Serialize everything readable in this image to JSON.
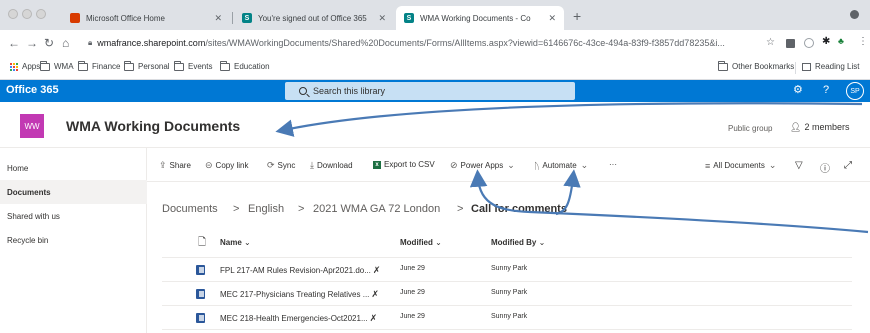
{
  "browser": {
    "tabs": [
      {
        "label": "Microsoft Office Home",
        "fav_color": "#d83b01",
        "fav_letter": ""
      },
      {
        "label": "You're signed out of Office 365",
        "fav_color": "#038387",
        "fav_letter": "S"
      },
      {
        "label": "WMA Working Documents - Co",
        "fav_color": "#038387",
        "fav_letter": "S"
      }
    ],
    "new_tab": "+",
    "url_host": "wmafrance.sharepoint.com",
    "url_path": "/sites/WMAWorkingDocuments/Shared%20Documents/Forms/AllItems.aspx?viewid=6146676c-43ce-494a-83f9-f3857dd78235&i...",
    "bookmarks": [
      "Apps",
      "WMA",
      "Finance",
      "Personal",
      "Events",
      "Education"
    ],
    "other_bookmarks": "Other Bookmarks",
    "reading_list": "Reading List"
  },
  "suite": {
    "title": "Office 365",
    "search_placeholder": "Search this library",
    "help": "?",
    "avatar": "SP"
  },
  "site": {
    "logo": "WW",
    "title": "WMA Working Documents",
    "group_type": "Public group",
    "members": "2 members"
  },
  "nav": [
    "Home",
    "Documents",
    "Shared with us",
    "Recycle bin"
  ],
  "commands": {
    "share": "Share",
    "copy_link": "Copy link",
    "sync": "Sync",
    "download": "Download",
    "export": "Export to CSV",
    "power_apps": "Power Apps",
    "automate": "Automate",
    "more": "···",
    "view": "All Documents"
  },
  "breadcrumb": [
    "Documents",
    "English",
    "2021 WMA GA 72 London",
    "Call for comments"
  ],
  "table": {
    "headers": {
      "name": "Name",
      "modified": "Modified",
      "modified_by": "Modified By"
    },
    "rows": [
      {
        "name": "FPL 217-AM Rules Revision-Apr2021.do...",
        "modified": "June 29",
        "modified_by": "Sunny Park"
      },
      {
        "name": "MEC 217-Physicians Treating Relatives ...",
        "modified": "June 29",
        "modified_by": "Sunny Park"
      },
      {
        "name": "MEC 218-Health Emergencies-Oct2021...",
        "modified": "June 29",
        "modified_by": "Sunny Park"
      }
    ]
  },
  "colors": {
    "suite_bar": "#0078d4",
    "logo": "#c239b3",
    "annotation_arrow": "#4a7ab5"
  }
}
